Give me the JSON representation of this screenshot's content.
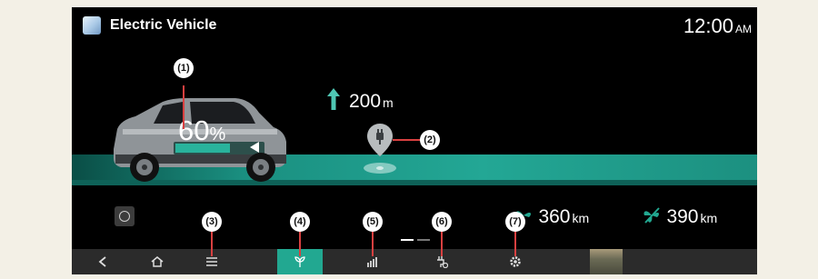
{
  "header": {
    "title": "Electric Vehicle",
    "time": "12:00",
    "ampm": "AM"
  },
  "vehicle": {
    "battery_percent": "60",
    "percent_sign": "%"
  },
  "navigation": {
    "distance": "200",
    "unit": "m"
  },
  "ranges": [
    {
      "value": "360",
      "unit": "km"
    },
    {
      "value": "390",
      "unit": "km"
    }
  ],
  "callouts": [
    "(1)",
    "(2)",
    "(3)",
    "(4)",
    "(5)",
    "(6)",
    "(7)"
  ],
  "bottom_bar": [
    "back-icon",
    "home-icon",
    "menu-icon",
    "eco-leaf-icon",
    "energy-stats-icon",
    "charging-settings-icon",
    "settings-icon"
  ],
  "colors": {
    "accent": "#22a891",
    "road": "#1a8f80",
    "callout_line": "#d84040"
  }
}
